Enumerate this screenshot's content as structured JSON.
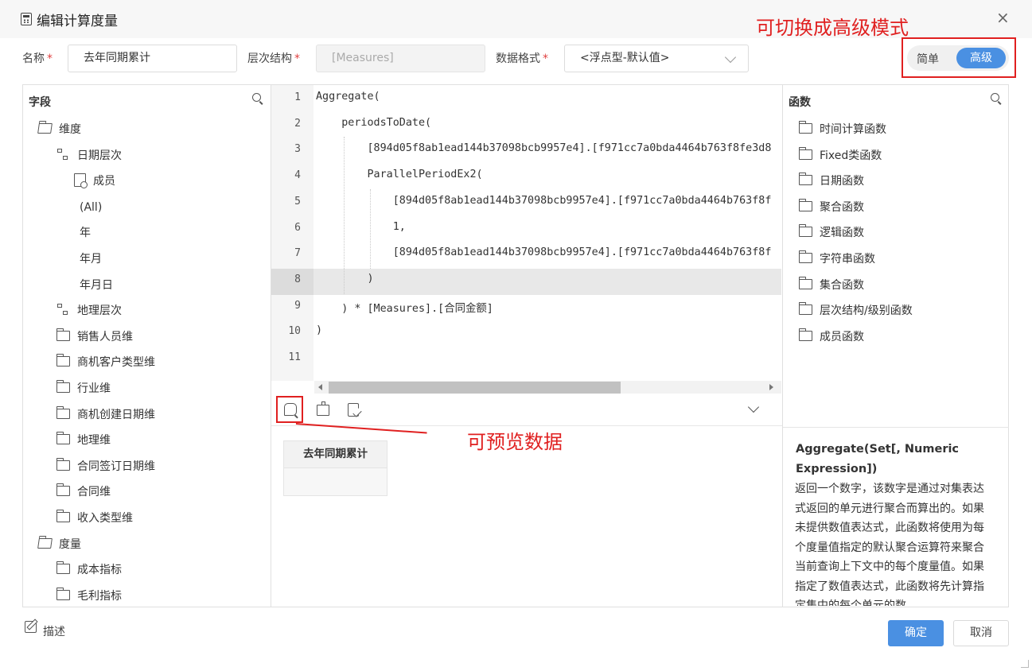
{
  "dialog": {
    "title": "编辑计算度量",
    "close_icon": "×"
  },
  "form": {
    "name_label": "名称",
    "name_value": "去年同期累计",
    "hierarchy_label": "层次结构",
    "hierarchy_value": "[Measures]",
    "format_label": "数据格式",
    "format_value": "<浮点型-默认值>",
    "required_mark": "*"
  },
  "mode_toggle": {
    "simple": "简单",
    "advanced": "高级",
    "active": "advanced"
  },
  "annotations": {
    "toggle_note": "可切换成高级模式",
    "preview_note": "可预览数据"
  },
  "fields_panel": {
    "title": "字段",
    "tree": [
      {
        "label": "维度",
        "icon": "folder-open-icon"
      },
      {
        "label": "日期层次",
        "icon": "hierarchy-icon"
      },
      {
        "label": "成员",
        "icon": "member-icon"
      },
      {
        "label": "(All)",
        "icon": ""
      },
      {
        "label": "年",
        "icon": ""
      },
      {
        "label": "年月",
        "icon": ""
      },
      {
        "label": "年月日",
        "icon": ""
      },
      {
        "label": "地理层次",
        "icon": "hierarchy-icon"
      },
      {
        "label": "销售人员维",
        "icon": "folder-icon"
      },
      {
        "label": "商机客户类型维",
        "icon": "folder-icon"
      },
      {
        "label": "行业维",
        "icon": "folder-icon"
      },
      {
        "label": "商机创建日期维",
        "icon": "folder-icon"
      },
      {
        "label": "地理维",
        "icon": "folder-icon"
      },
      {
        "label": "合同签订日期维",
        "icon": "folder-icon"
      },
      {
        "label": "合同维",
        "icon": "folder-icon"
      },
      {
        "label": "收入类型维",
        "icon": "folder-icon"
      },
      {
        "label": "度量",
        "icon": "folder-open-icon"
      },
      {
        "label": "成本指标",
        "icon": "folder-icon"
      },
      {
        "label": "毛利指标",
        "icon": "folder-icon"
      }
    ]
  },
  "editor": {
    "line_numbers": [
      "1",
      "2",
      "3",
      "4",
      "5",
      "6",
      "7",
      "8",
      "9",
      "10",
      "11"
    ],
    "lines": [
      "Aggregate(",
      "    periodsToDate(",
      "        [894d05f8ab1ead144b37098bcb9957e4].[f971cc7a0bda4464b763f8fe3d8",
      "        ParallelPeriodEx2(",
      "            [894d05f8ab1ead144b37098bcb9957e4].[f971cc7a0bda4464b763f8f",
      "            1,",
      "            [894d05f8ab1ead144b37098bcb9957e4].[f971cc7a0bda4464b763f8f",
      "        )",
      "    ) * [Measures].[合同金额]",
      ")",
      ""
    ],
    "active_line": 8
  },
  "preview": {
    "column_header": "去年同期累计",
    "cell_value": ""
  },
  "functions_panel": {
    "title": "函数",
    "items": [
      "时间计算函数",
      "Fixed类函数",
      "日期函数",
      "聚合函数",
      "逻辑函数",
      "字符串函数",
      "集合函数",
      "层次结构/级别函数",
      "成员函数"
    ],
    "help_title": "Aggregate(Set[, Numeric Expression])",
    "help_text": "返回一个数字，该数字是通过对集表达式返回的单元进行聚合而算出的。如果未提供数值表达式，此函数将使用为每个度量值指定的默认聚合运算符来聚合当前查询上下文中的每个度量值。如果指定了数值表达式，此函数将先计算指定集中的每个单元的数"
  },
  "footer": {
    "describe_label": "描述",
    "ok_label": "确定",
    "cancel_label": "取消"
  },
  "colors": {
    "accent": "#4a90e2",
    "annotation": "#e02020"
  }
}
